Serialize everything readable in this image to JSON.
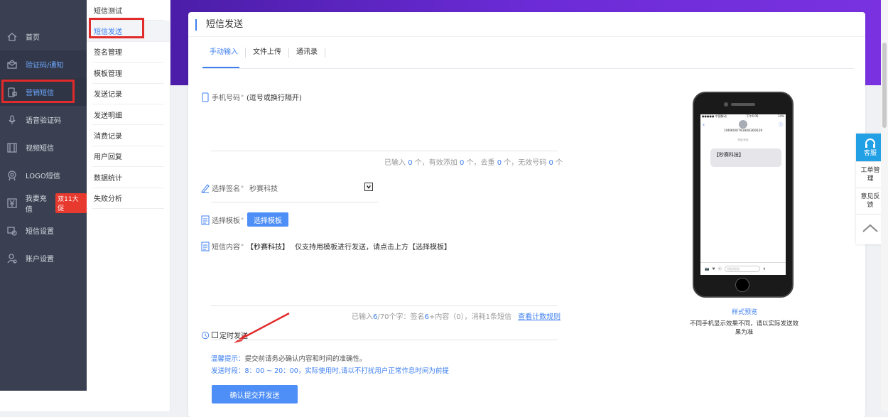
{
  "sidebar": {
    "items": [
      {
        "label": "首页",
        "icon": "home-icon"
      },
      {
        "label": "验证码/通知",
        "icon": "envelope-icon"
      },
      {
        "label": "营销短信",
        "icon": "phone-message-icon"
      },
      {
        "label": "语音验证码",
        "icon": "microphone-icon"
      },
      {
        "label": "视频短信",
        "icon": "film-icon"
      },
      {
        "label": "LOGO短信",
        "icon": "logo-badge-icon"
      },
      {
        "label": "我要充值",
        "icon": "yen-icon",
        "badge": "双11大促"
      },
      {
        "label": "短信设置",
        "icon": "settings-icon"
      },
      {
        "label": "账户设置",
        "icon": "user-gear-icon"
      }
    ]
  },
  "submenu": {
    "items": [
      "短信测试",
      "短信发送",
      "签名管理",
      "模板管理",
      "发送记录",
      "发送明细",
      "消费记录",
      "用户回复",
      "数据统计",
      "失败分析"
    ]
  },
  "page": {
    "title": "短信发送",
    "tabs": [
      "手动输入",
      "文件上传",
      "通讯录"
    ]
  },
  "form": {
    "phone_label": "手机号码",
    "phone_hint": "(逗号或换行隔开)",
    "phone_counter": {
      "prefix": "已输入",
      "input": "0",
      "unit1": "个，有效添加",
      "valid": "0",
      "unit2": "个，去重",
      "dedup": "0",
      "unit3": "个，无效号码",
      "invalid": "0",
      "unit4": "个"
    },
    "signature_label": "选择签名",
    "signature_value": "秒赛科技",
    "template_label": "选择模板",
    "template_button": "选择模板",
    "content_label": "短信内容",
    "content_sig": "【秒赛科技】",
    "content_hint": "仅支持用模板进行发送，请点击上方【选择模板】",
    "content_counter": {
      "prefix": "已输入",
      "count": "6",
      "mid": "/70个字：签名",
      "sig": "6",
      "tail": "+内容（0），消耗1条短信",
      "rule_link": "查看计数规则"
    },
    "schedule_label": "定时发送",
    "tip_label": "温馨提示：",
    "tip_text": "提交前请务必确认内容和时间的准确性。",
    "time_text": "发送时段：8：00 ~ 20：00，实际使用时,请以不打扰用户正常作息时间为前提",
    "submit_button": "确认提交开发送"
  },
  "preview": {
    "status_left": "●●●●● 中国移动",
    "status_center": "下午6:06",
    "status_right": "24%",
    "number": "1069000791808360629",
    "sub_line": "短信/彩信",
    "bubble": "【秒赛科技】",
    "input_placeholder": "短信/彩信",
    "link": "样式预览",
    "note": "不同手机显示效果不同，请以实际发送效果为准"
  },
  "floatbar": {
    "service": "客服",
    "ticket": "工单管理",
    "feedback": "意见反馈"
  },
  "colors": {
    "accent": "#3d7ff0",
    "sidebar": "#3a4051",
    "highlight": "#e12a2a",
    "banner": "#6b2bd6"
  }
}
